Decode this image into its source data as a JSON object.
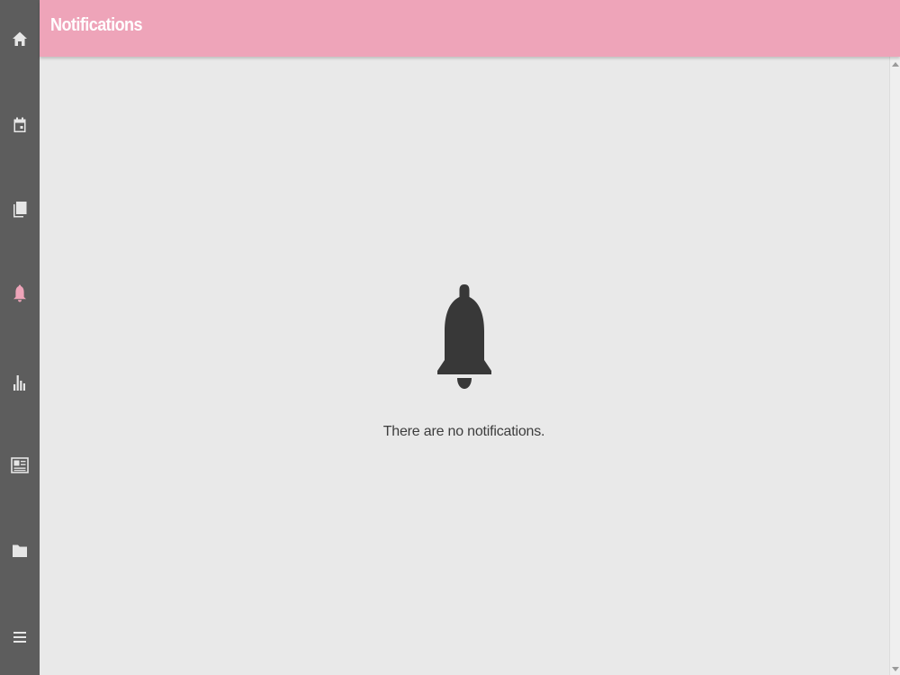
{
  "header": {
    "title": "Notifications"
  },
  "sidebar": {
    "items": [
      {
        "icon": "home-icon",
        "active": false
      },
      {
        "icon": "calendar-icon",
        "active": false
      },
      {
        "icon": "book-icon",
        "active": false
      },
      {
        "icon": "bell-icon",
        "active": true
      },
      {
        "icon": "bar-chart-icon",
        "active": false
      },
      {
        "icon": "newspaper-icon",
        "active": false
      },
      {
        "icon": "folder-icon",
        "active": false
      },
      {
        "icon": "menu-icon",
        "active": false
      }
    ]
  },
  "main": {
    "empty_icon": "bell-icon",
    "empty_message": "There are no notifications."
  },
  "colors": {
    "header": "#eea4b9",
    "sidebar": "#5d5d5d",
    "active_icon": "#eea4b9",
    "icon": "#e6e6e6",
    "content_bg": "#e9e9e9",
    "empty_icon": "#383838"
  }
}
